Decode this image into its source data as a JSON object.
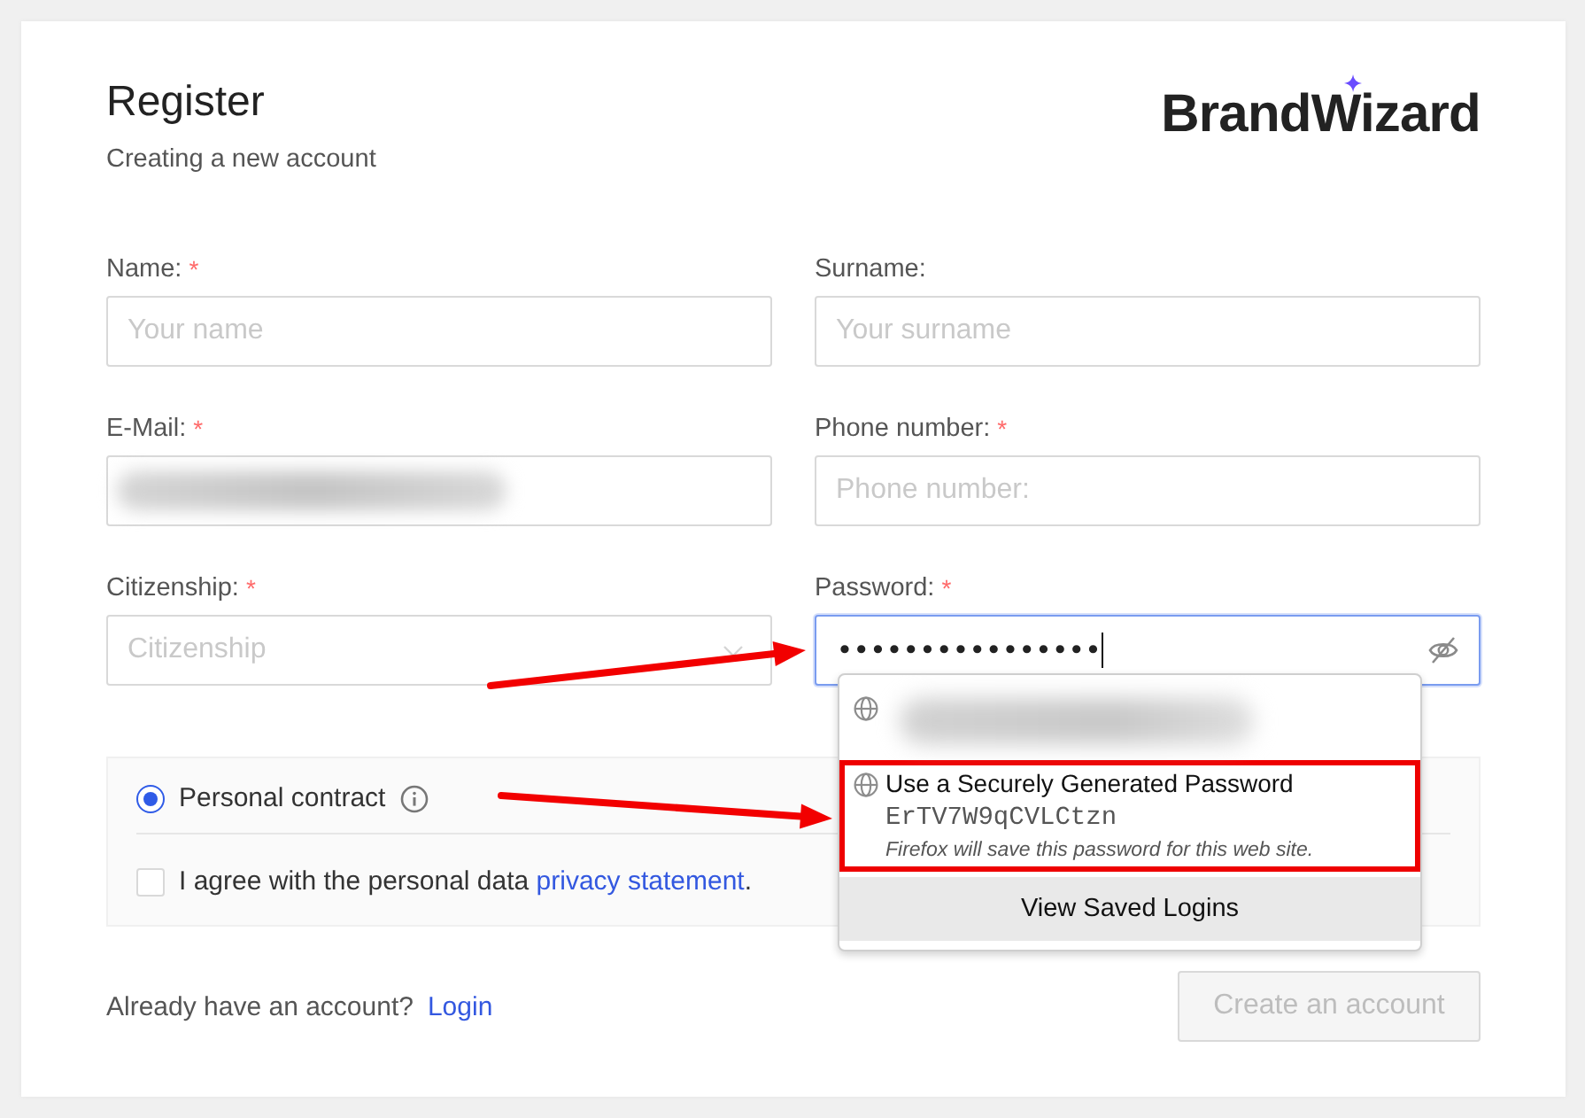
{
  "header": {
    "title": "Register",
    "subtitle": "Creating a new account",
    "logo": "BrandWizard"
  },
  "fields": [
    {
      "label": "Name:",
      "required_mark": "*",
      "kind": "text",
      "placeholder": "Your name"
    },
    {
      "label": "Surname:",
      "kind": "text",
      "placeholder": "Your surname"
    },
    {
      "label": "E-Mail:",
      "required_mark": "*",
      "kind": "text",
      "redacted": true
    },
    {
      "label": "Phone number:",
      "required_mark": "*",
      "kind": "text",
      "placeholder": "Phone number:"
    },
    {
      "label": "Citizenship:",
      "required_mark": "*",
      "kind": "select",
      "placeholder": "Citizenship"
    },
    {
      "label": "Password:",
      "required_mark": "*",
      "kind": "password",
      "value": "••••••••••••••••",
      "focused": true,
      "annotation_arrow": true
    }
  ],
  "autocomplete": {
    "items": [
      {
        "kind": "saved_login",
        "redacted": true,
        "highlighted": false
      },
      {
        "kind": "generated",
        "title": "Use a Securely Generated Password",
        "password": "ErTV7W9qCVLCtzn",
        "note": "Firefox will save this password for this web site.",
        "highlighted": true,
        "annotation_arrow": true
      }
    ],
    "footer": "View Saved Logins"
  },
  "contract": {
    "options": [
      {
        "label": "Personal contract",
        "selected": true
      }
    ],
    "agreement": {
      "checked": false,
      "text": "I agree with the personal data",
      "link": "privacy statement",
      "suffix": "."
    }
  },
  "footer": {
    "prompt": "Already have an account?",
    "link": "Login",
    "button": {
      "label": "Create an account",
      "disabled": true
    }
  }
}
